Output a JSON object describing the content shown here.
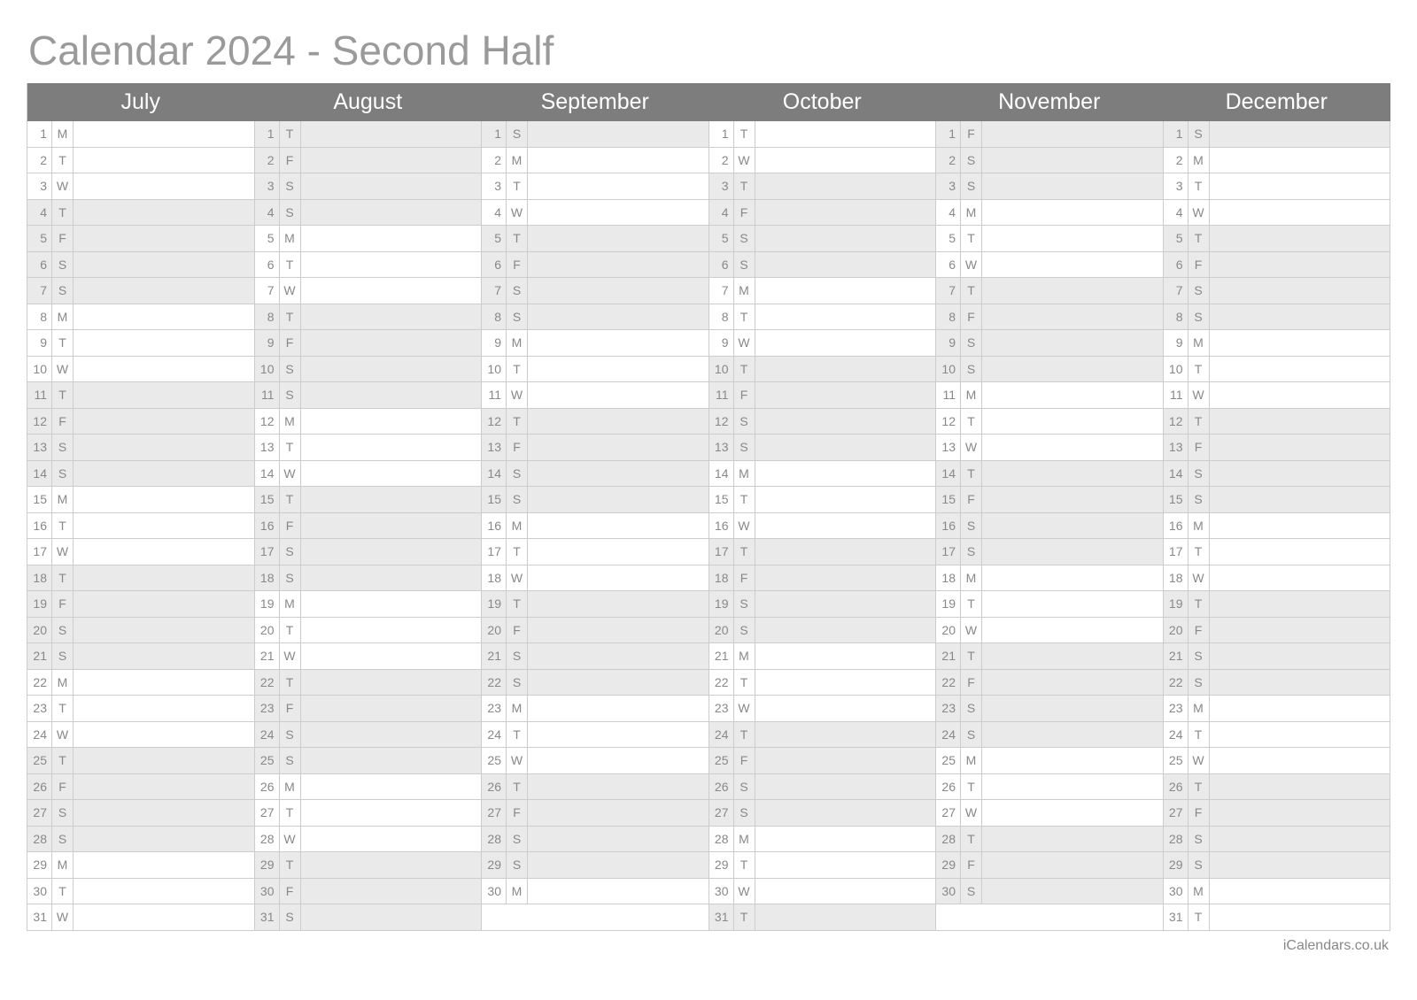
{
  "title": "Calendar 2024 - Second Half",
  "footer": "iCalendars.co.uk",
  "maxDays": 31,
  "months": [
    {
      "name": "July",
      "days": [
        {
          "n": "1",
          "d": "M",
          "s": false
        },
        {
          "n": "2",
          "d": "T",
          "s": false
        },
        {
          "n": "3",
          "d": "W",
          "s": false
        },
        {
          "n": "4",
          "d": "T",
          "s": true
        },
        {
          "n": "5",
          "d": "F",
          "s": true
        },
        {
          "n": "6",
          "d": "S",
          "s": true
        },
        {
          "n": "7",
          "d": "S",
          "s": true
        },
        {
          "n": "8",
          "d": "M",
          "s": false
        },
        {
          "n": "9",
          "d": "T",
          "s": false
        },
        {
          "n": "10",
          "d": "W",
          "s": false
        },
        {
          "n": "11",
          "d": "T",
          "s": true
        },
        {
          "n": "12",
          "d": "F",
          "s": true
        },
        {
          "n": "13",
          "d": "S",
          "s": true
        },
        {
          "n": "14",
          "d": "S",
          "s": true
        },
        {
          "n": "15",
          "d": "M",
          "s": false
        },
        {
          "n": "16",
          "d": "T",
          "s": false
        },
        {
          "n": "17",
          "d": "W",
          "s": false
        },
        {
          "n": "18",
          "d": "T",
          "s": true
        },
        {
          "n": "19",
          "d": "F",
          "s": true
        },
        {
          "n": "20",
          "d": "S",
          "s": true
        },
        {
          "n": "21",
          "d": "S",
          "s": true
        },
        {
          "n": "22",
          "d": "M",
          "s": false
        },
        {
          "n": "23",
          "d": "T",
          "s": false
        },
        {
          "n": "24",
          "d": "W",
          "s": false
        },
        {
          "n": "25",
          "d": "T",
          "s": true
        },
        {
          "n": "26",
          "d": "F",
          "s": true
        },
        {
          "n": "27",
          "d": "S",
          "s": true
        },
        {
          "n": "28",
          "d": "S",
          "s": true
        },
        {
          "n": "29",
          "d": "M",
          "s": false
        },
        {
          "n": "30",
          "d": "T",
          "s": false
        },
        {
          "n": "31",
          "d": "W",
          "s": false
        }
      ]
    },
    {
      "name": "August",
      "days": [
        {
          "n": "1",
          "d": "T",
          "s": true
        },
        {
          "n": "2",
          "d": "F",
          "s": true
        },
        {
          "n": "3",
          "d": "S",
          "s": true
        },
        {
          "n": "4",
          "d": "S",
          "s": true
        },
        {
          "n": "5",
          "d": "M",
          "s": false
        },
        {
          "n": "6",
          "d": "T",
          "s": false
        },
        {
          "n": "7",
          "d": "W",
          "s": false
        },
        {
          "n": "8",
          "d": "T",
          "s": true
        },
        {
          "n": "9",
          "d": "F",
          "s": true
        },
        {
          "n": "10",
          "d": "S",
          "s": true
        },
        {
          "n": "11",
          "d": "S",
          "s": true
        },
        {
          "n": "12",
          "d": "M",
          "s": false
        },
        {
          "n": "13",
          "d": "T",
          "s": false
        },
        {
          "n": "14",
          "d": "W",
          "s": false
        },
        {
          "n": "15",
          "d": "T",
          "s": true
        },
        {
          "n": "16",
          "d": "F",
          "s": true
        },
        {
          "n": "17",
          "d": "S",
          "s": true
        },
        {
          "n": "18",
          "d": "S",
          "s": true
        },
        {
          "n": "19",
          "d": "M",
          "s": false
        },
        {
          "n": "20",
          "d": "T",
          "s": false
        },
        {
          "n": "21",
          "d": "W",
          "s": false
        },
        {
          "n": "22",
          "d": "T",
          "s": true
        },
        {
          "n": "23",
          "d": "F",
          "s": true
        },
        {
          "n": "24",
          "d": "S",
          "s": true
        },
        {
          "n": "25",
          "d": "S",
          "s": true
        },
        {
          "n": "26",
          "d": "M",
          "s": false
        },
        {
          "n": "27",
          "d": "T",
          "s": false
        },
        {
          "n": "28",
          "d": "W",
          "s": false
        },
        {
          "n": "29",
          "d": "T",
          "s": true
        },
        {
          "n": "30",
          "d": "F",
          "s": true
        },
        {
          "n": "31",
          "d": "S",
          "s": true
        }
      ]
    },
    {
      "name": "September",
      "days": [
        {
          "n": "1",
          "d": "S",
          "s": true
        },
        {
          "n": "2",
          "d": "M",
          "s": false
        },
        {
          "n": "3",
          "d": "T",
          "s": false
        },
        {
          "n": "4",
          "d": "W",
          "s": false
        },
        {
          "n": "5",
          "d": "T",
          "s": true
        },
        {
          "n": "6",
          "d": "F",
          "s": true
        },
        {
          "n": "7",
          "d": "S",
          "s": true
        },
        {
          "n": "8",
          "d": "S",
          "s": true
        },
        {
          "n": "9",
          "d": "M",
          "s": false
        },
        {
          "n": "10",
          "d": "T",
          "s": false
        },
        {
          "n": "11",
          "d": "W",
          "s": false
        },
        {
          "n": "12",
          "d": "T",
          "s": true
        },
        {
          "n": "13",
          "d": "F",
          "s": true
        },
        {
          "n": "14",
          "d": "S",
          "s": true
        },
        {
          "n": "15",
          "d": "S",
          "s": true
        },
        {
          "n": "16",
          "d": "M",
          "s": false
        },
        {
          "n": "17",
          "d": "T",
          "s": false
        },
        {
          "n": "18",
          "d": "W",
          "s": false
        },
        {
          "n": "19",
          "d": "T",
          "s": true
        },
        {
          "n": "20",
          "d": "F",
          "s": true
        },
        {
          "n": "21",
          "d": "S",
          "s": true
        },
        {
          "n": "22",
          "d": "S",
          "s": true
        },
        {
          "n": "23",
          "d": "M",
          "s": false
        },
        {
          "n": "24",
          "d": "T",
          "s": false
        },
        {
          "n": "25",
          "d": "W",
          "s": false
        },
        {
          "n": "26",
          "d": "T",
          "s": true
        },
        {
          "n": "27",
          "d": "F",
          "s": true
        },
        {
          "n": "28",
          "d": "S",
          "s": true
        },
        {
          "n": "29",
          "d": "S",
          "s": true
        },
        {
          "n": "30",
          "d": "M",
          "s": false
        }
      ]
    },
    {
      "name": "October",
      "days": [
        {
          "n": "1",
          "d": "T",
          "s": false
        },
        {
          "n": "2",
          "d": "W",
          "s": false
        },
        {
          "n": "3",
          "d": "T",
          "s": true
        },
        {
          "n": "4",
          "d": "F",
          "s": true
        },
        {
          "n": "5",
          "d": "S",
          "s": true
        },
        {
          "n": "6",
          "d": "S",
          "s": true
        },
        {
          "n": "7",
          "d": "M",
          "s": false
        },
        {
          "n": "8",
          "d": "T",
          "s": false
        },
        {
          "n": "9",
          "d": "W",
          "s": false
        },
        {
          "n": "10",
          "d": "T",
          "s": true
        },
        {
          "n": "11",
          "d": "F",
          "s": true
        },
        {
          "n": "12",
          "d": "S",
          "s": true
        },
        {
          "n": "13",
          "d": "S",
          "s": true
        },
        {
          "n": "14",
          "d": "M",
          "s": false
        },
        {
          "n": "15",
          "d": "T",
          "s": false
        },
        {
          "n": "16",
          "d": "W",
          "s": false
        },
        {
          "n": "17",
          "d": "T",
          "s": true
        },
        {
          "n": "18",
          "d": "F",
          "s": true
        },
        {
          "n": "19",
          "d": "S",
          "s": true
        },
        {
          "n": "20",
          "d": "S",
          "s": true
        },
        {
          "n": "21",
          "d": "M",
          "s": false
        },
        {
          "n": "22",
          "d": "T",
          "s": false
        },
        {
          "n": "23",
          "d": "W",
          "s": false
        },
        {
          "n": "24",
          "d": "T",
          "s": true
        },
        {
          "n": "25",
          "d": "F",
          "s": true
        },
        {
          "n": "26",
          "d": "S",
          "s": true
        },
        {
          "n": "27",
          "d": "S",
          "s": true
        },
        {
          "n": "28",
          "d": "M",
          "s": false
        },
        {
          "n": "29",
          "d": "T",
          "s": false
        },
        {
          "n": "30",
          "d": "W",
          "s": false
        },
        {
          "n": "31",
          "d": "T",
          "s": true
        }
      ]
    },
    {
      "name": "November",
      "days": [
        {
          "n": "1",
          "d": "F",
          "s": true
        },
        {
          "n": "2",
          "d": "S",
          "s": true
        },
        {
          "n": "3",
          "d": "S",
          "s": true
        },
        {
          "n": "4",
          "d": "M",
          "s": false
        },
        {
          "n": "5",
          "d": "T",
          "s": false
        },
        {
          "n": "6",
          "d": "W",
          "s": false
        },
        {
          "n": "7",
          "d": "T",
          "s": true
        },
        {
          "n": "8",
          "d": "F",
          "s": true
        },
        {
          "n": "9",
          "d": "S",
          "s": true
        },
        {
          "n": "10",
          "d": "S",
          "s": true
        },
        {
          "n": "11",
          "d": "M",
          "s": false
        },
        {
          "n": "12",
          "d": "T",
          "s": false
        },
        {
          "n": "13",
          "d": "W",
          "s": false
        },
        {
          "n": "14",
          "d": "T",
          "s": true
        },
        {
          "n": "15",
          "d": "F",
          "s": true
        },
        {
          "n": "16",
          "d": "S",
          "s": true
        },
        {
          "n": "17",
          "d": "S",
          "s": true
        },
        {
          "n": "18",
          "d": "M",
          "s": false
        },
        {
          "n": "19",
          "d": "T",
          "s": false
        },
        {
          "n": "20",
          "d": "W",
          "s": false
        },
        {
          "n": "21",
          "d": "T",
          "s": true
        },
        {
          "n": "22",
          "d": "F",
          "s": true
        },
        {
          "n": "23",
          "d": "S",
          "s": true
        },
        {
          "n": "24",
          "d": "S",
          "s": true
        },
        {
          "n": "25",
          "d": "M",
          "s": false
        },
        {
          "n": "26",
          "d": "T",
          "s": false
        },
        {
          "n": "27",
          "d": "W",
          "s": false
        },
        {
          "n": "28",
          "d": "T",
          "s": true
        },
        {
          "n": "29",
          "d": "F",
          "s": true
        },
        {
          "n": "30",
          "d": "S",
          "s": true
        }
      ]
    },
    {
      "name": "December",
      "days": [
        {
          "n": "1",
          "d": "S",
          "s": true
        },
        {
          "n": "2",
          "d": "M",
          "s": false
        },
        {
          "n": "3",
          "d": "T",
          "s": false
        },
        {
          "n": "4",
          "d": "W",
          "s": false
        },
        {
          "n": "5",
          "d": "T",
          "s": true
        },
        {
          "n": "6",
          "d": "F",
          "s": true
        },
        {
          "n": "7",
          "d": "S",
          "s": true
        },
        {
          "n": "8",
          "d": "S",
          "s": true
        },
        {
          "n": "9",
          "d": "M",
          "s": false
        },
        {
          "n": "10",
          "d": "T",
          "s": false
        },
        {
          "n": "11",
          "d": "W",
          "s": false
        },
        {
          "n": "12",
          "d": "T",
          "s": true
        },
        {
          "n": "13",
          "d": "F",
          "s": true
        },
        {
          "n": "14",
          "d": "S",
          "s": true
        },
        {
          "n": "15",
          "d": "S",
          "s": true
        },
        {
          "n": "16",
          "d": "M",
          "s": false
        },
        {
          "n": "17",
          "d": "T",
          "s": false
        },
        {
          "n": "18",
          "d": "W",
          "s": false
        },
        {
          "n": "19",
          "d": "T",
          "s": true
        },
        {
          "n": "20",
          "d": "F",
          "s": true
        },
        {
          "n": "21",
          "d": "S",
          "s": true
        },
        {
          "n": "22",
          "d": "S",
          "s": true
        },
        {
          "n": "23",
          "d": "M",
          "s": false
        },
        {
          "n": "24",
          "d": "T",
          "s": false
        },
        {
          "n": "25",
          "d": "W",
          "s": false
        },
        {
          "n": "26",
          "d": "T",
          "s": true
        },
        {
          "n": "27",
          "d": "F",
          "s": true
        },
        {
          "n": "28",
          "d": "S",
          "s": true
        },
        {
          "n": "29",
          "d": "S",
          "s": true
        },
        {
          "n": "30",
          "d": "M",
          "s": false
        },
        {
          "n": "31",
          "d": "T",
          "s": false
        }
      ]
    }
  ]
}
